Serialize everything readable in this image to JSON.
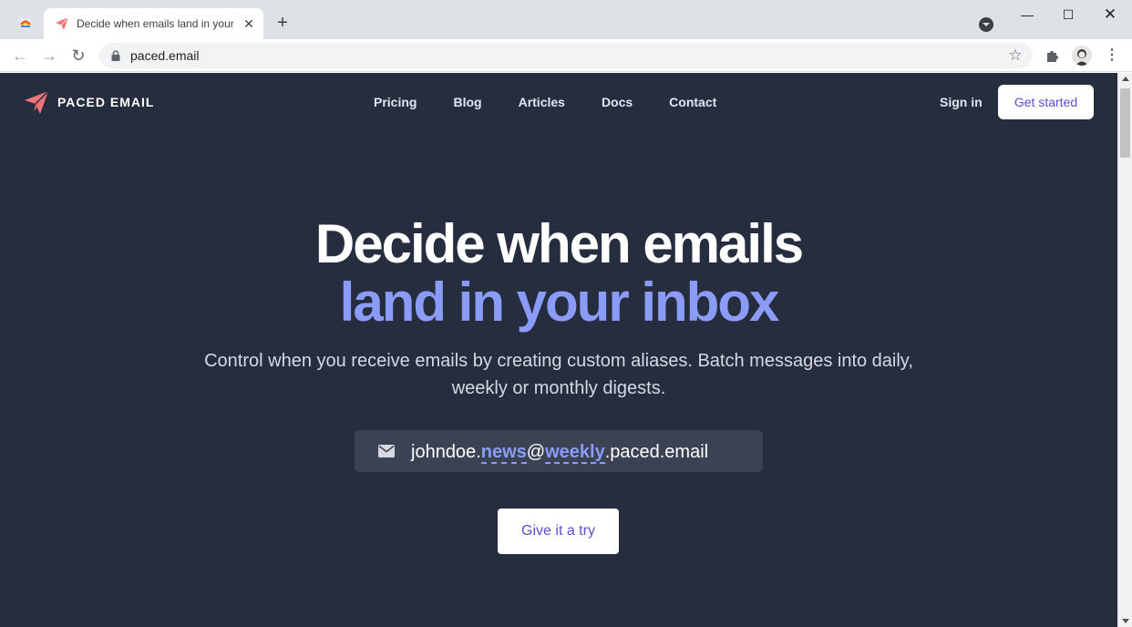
{
  "browser": {
    "tab_title": "Decide when emails land in your inbox",
    "url": "paced.email",
    "tab_close": "✕",
    "new_tab": "+",
    "window_controls": {
      "minimize": "—",
      "maximize": "☐",
      "close": "✕"
    }
  },
  "site": {
    "logo_text": "PACED EMAIL",
    "brand_color": "#f0737a",
    "accent_color": "#8b9cf8",
    "nav": [
      "Pricing",
      "Blog",
      "Articles",
      "Docs",
      "Contact"
    ],
    "sign_in": "Sign in",
    "get_started": "Get started"
  },
  "hero": {
    "title_line1": "Decide when emails",
    "title_line2": "land in your inbox",
    "subtitle": "Control when you receive emails by creating custom aliases. Batch messages into daily, weekly or monthly digests.",
    "email": {
      "user": "johndoe.",
      "alias": "news",
      "at": "@",
      "frequency": "weekly",
      "domain": ".paced.email"
    },
    "cta": "Give it a try"
  }
}
